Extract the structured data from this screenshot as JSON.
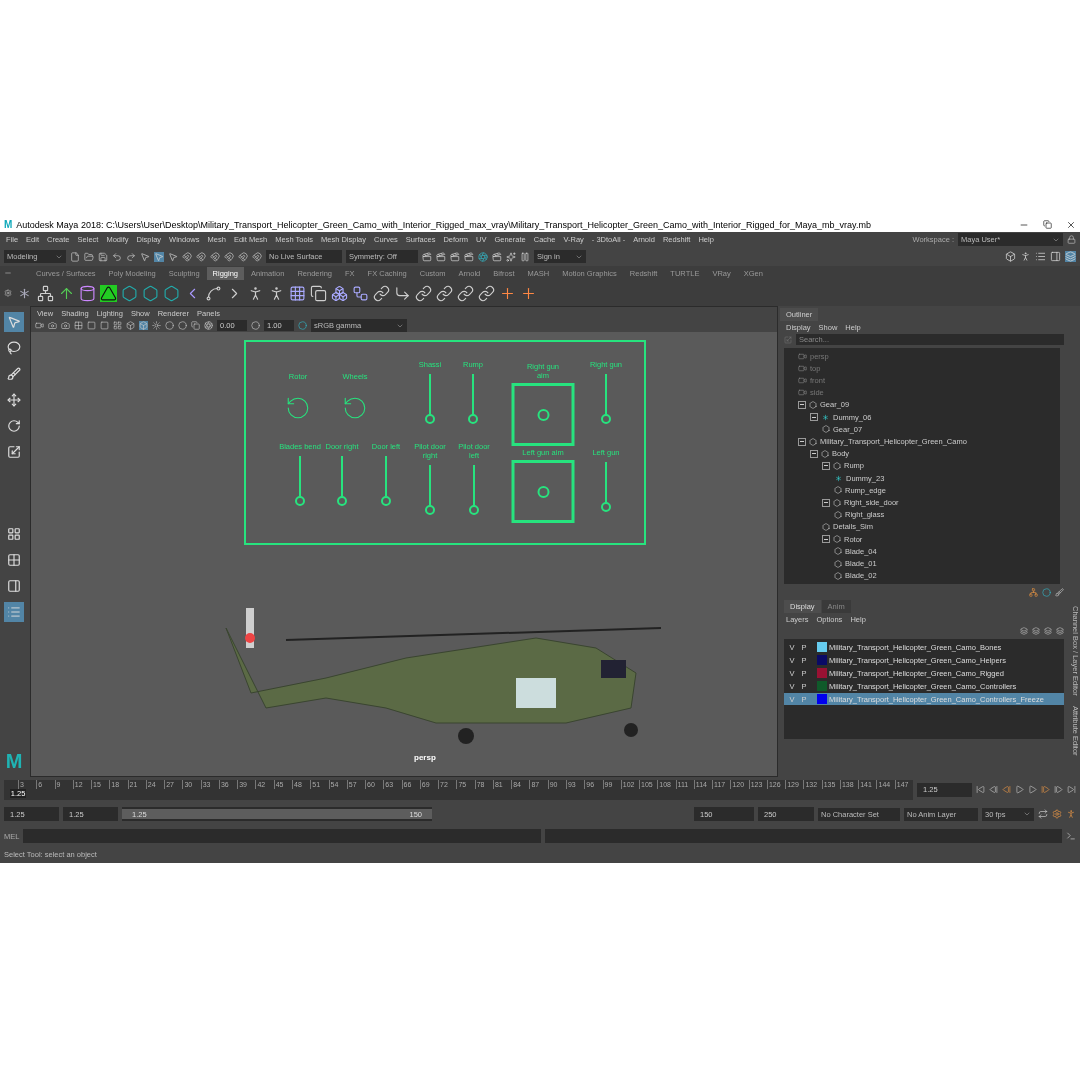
{
  "window": {
    "logo": "M",
    "title": "Autodesk Maya 2018: C:\\Users\\User\\Desktop\\Military_Transport_Helicopter_Green_Camo_with_Interior_Rigged_max_vray\\Military_Transport_Helicopter_Green_Camo_with_Interior_Rigged_for_Maya_mb_vray.mb"
  },
  "menu_bar": {
    "items": [
      "File",
      "Edit",
      "Create",
      "Select",
      "Modify",
      "Display",
      "Windows",
      "Mesh",
      "Edit Mesh",
      "Mesh Tools",
      "Mesh Display",
      "Curves",
      "Surfaces",
      "Deform",
      "UV",
      "Generate",
      "Cache",
      "V-Ray",
      "- 3DtoAll -",
      "Arnold",
      "Redshift",
      "Help"
    ],
    "workspace_label": "Workspace :",
    "workspace": "Maya User*"
  },
  "status_line": {
    "mode": "Modeling",
    "live_surface": "No Live Surface",
    "symmetry": "Symmetry: Off",
    "sign_in": "Sign in"
  },
  "shelf": {
    "tabs": [
      {
        "label": "Curves / Surfaces",
        "selected": false
      },
      {
        "label": "Poly Modeling",
        "selected": false
      },
      {
        "label": "Sculpting",
        "selected": false
      },
      {
        "label": "Rigging",
        "selected": true
      },
      {
        "label": "Animation",
        "selected": false
      },
      {
        "label": "Rendering",
        "selected": false
      },
      {
        "label": "FX",
        "selected": false
      },
      {
        "label": "FX Caching",
        "selected": false
      },
      {
        "label": "Custom",
        "selected": false
      },
      {
        "label": "Arnold",
        "selected": false
      },
      {
        "label": "Bifrost",
        "selected": false
      },
      {
        "label": "MASH",
        "selected": false
      },
      {
        "label": "Motion Graphics",
        "selected": false
      },
      {
        "label": "Redshift",
        "selected": false
      },
      {
        "label": "TURTLE",
        "selected": false
      },
      {
        "label": "VRay",
        "selected": false
      },
      {
        "label": "XGen",
        "selected": false
      }
    ]
  },
  "viewport": {
    "menus": [
      "View",
      "Shading",
      "Lighting",
      "Show",
      "Renderer",
      "Panels"
    ],
    "exposure": "0.00",
    "gamma": "1.00",
    "color_space": "sRGB gamma",
    "camera_label": "persp",
    "logo": "M",
    "controls": [
      {
        "kind": "rotate",
        "label": "Rotor"
      },
      {
        "kind": "rotate",
        "label": "Wheels"
      },
      {
        "kind": "slider",
        "label": "Shassi"
      },
      {
        "kind": "slider",
        "label": "Rump"
      },
      {
        "kind": "aim",
        "label": "Right gun aim"
      },
      {
        "kind": "slider",
        "label": "Right gun"
      },
      {
        "kind": "slider",
        "label": "Blades bend"
      },
      {
        "kind": "slider",
        "label": "Door right"
      },
      {
        "kind": "slider",
        "label": "Door left"
      },
      {
        "kind": "slider",
        "label": "Pilot door right"
      },
      {
        "kind": "slider",
        "label": "Pilot door left"
      },
      {
        "kind": "aim",
        "label": "Left gun aim"
      },
      {
        "kind": "slider",
        "label": "Left gun"
      }
    ]
  },
  "outliner": {
    "title": "Outliner",
    "menus": [
      "Display",
      "Show",
      "Help"
    ],
    "search": {
      "placeholder": "Search..."
    },
    "items": [
      {
        "kind": "camera",
        "label": "persp"
      },
      {
        "kind": "camera",
        "label": "top"
      },
      {
        "kind": "camera",
        "label": "front"
      },
      {
        "kind": "camera",
        "label": "side"
      },
      {
        "kind": "transform",
        "label": "Gear_09",
        "expanded": true,
        "children": [
          {
            "kind": "dummy",
            "label": "Dummy_06",
            "expanded": true,
            "children": [
              {
                "kind": "transform",
                "label": "Gear_07"
              }
            ]
          }
        ]
      },
      {
        "kind": "transform",
        "label": "Military_Transport_Helicopter_Green_Camo",
        "expanded": true,
        "children": [
          {
            "kind": "transform",
            "label": "Body",
            "expanded": true,
            "children": [
              {
                "kind": "transform",
                "label": "Rump",
                "expanded": true,
                "children": [
                  {
                    "kind": "dummy",
                    "label": "Dummy_23"
                  },
                  {
                    "kind": "transform",
                    "label": "Rump_edge"
                  }
                ]
              },
              {
                "kind": "transform",
                "label": "Right_side_door",
                "expanded": true,
                "children": [
                  {
                    "kind": "transform",
                    "label": "Right_glass"
                  }
                ]
              },
              {
                "kind": "transform",
                "label": "Details_Sim"
              },
              {
                "kind": "transform",
                "label": "Rotor",
                "expanded": true,
                "children": [
                  {
                    "kind": "transform",
                    "label": "Blade_04"
                  },
                  {
                    "kind": "transform",
                    "label": "Blade_01"
                  },
                  {
                    "kind": "transform",
                    "label": "Blade_02"
                  }
                ]
              }
            ]
          }
        ]
      }
    ]
  },
  "layer_editor": {
    "tabs": [
      {
        "label": "Display",
        "selected": true
      },
      {
        "label": "Anim",
        "selected": false
      }
    ],
    "menus": [
      "Layers",
      "Options",
      "Help"
    ],
    "layers": [
      {
        "visible": "V",
        "playback": "P",
        "color": "#66ccee",
        "name": "Military_Transport_Helicopter_Green_Camo_Bones",
        "selected": false
      },
      {
        "visible": "V",
        "playback": "P",
        "color": "#0a0a66",
        "name": "Military_Transport_Helicopter_Green_Camo_Helpers",
        "selected": false
      },
      {
        "visible": "V",
        "playback": "P",
        "color": "#991133",
        "name": "Military_Transport_Helicopter_Green_Camo_Rigged",
        "selected": false
      },
      {
        "visible": "V",
        "playback": "P",
        "color": "#0f5a2a",
        "name": "Military_Transport_Helicopter_Green_Camo_Controllers",
        "selected": false
      },
      {
        "visible": "V",
        "playback": "P",
        "color": "#0000ee",
        "name": "Military_Transport_Helicopter_Green_Camo_Controllers_Freeze",
        "selected": true
      }
    ]
  },
  "side_tabs": [
    "Channel Box / Layer Editor",
    "Attribute Editor"
  ],
  "time_slider": {
    "current": "1.25",
    "level": 0.002,
    "ticks": [
      "3",
      "6",
      "9",
      "12",
      "15",
      "18",
      "21",
      "24",
      "27",
      "30",
      "33",
      "36",
      "39",
      "42",
      "45",
      "48",
      "51",
      "54",
      "57",
      "60",
      "63",
      "66",
      "69",
      "72",
      "75",
      "78",
      "81",
      "84",
      "87",
      "90",
      "93",
      "96",
      "99",
      "102",
      "105",
      "108",
      "111",
      "114",
      "117",
      "120",
      "123",
      "126",
      "129",
      "132",
      "135",
      "138",
      "141",
      "144",
      "147"
    ],
    "frame_field": "1.25"
  },
  "range_slider": {
    "level": 1,
    "start": "1.25",
    "playback_start": "1.25",
    "handle_start": "1.25",
    "handle_end": "150",
    "playback_end": "150",
    "end": "250",
    "character_set": "No Character Set",
    "anim_layer": "No Anim Layer",
    "fps": "30 fps"
  },
  "command_line": {
    "label": "MEL"
  },
  "help_line": "Select Tool: select an object"
}
